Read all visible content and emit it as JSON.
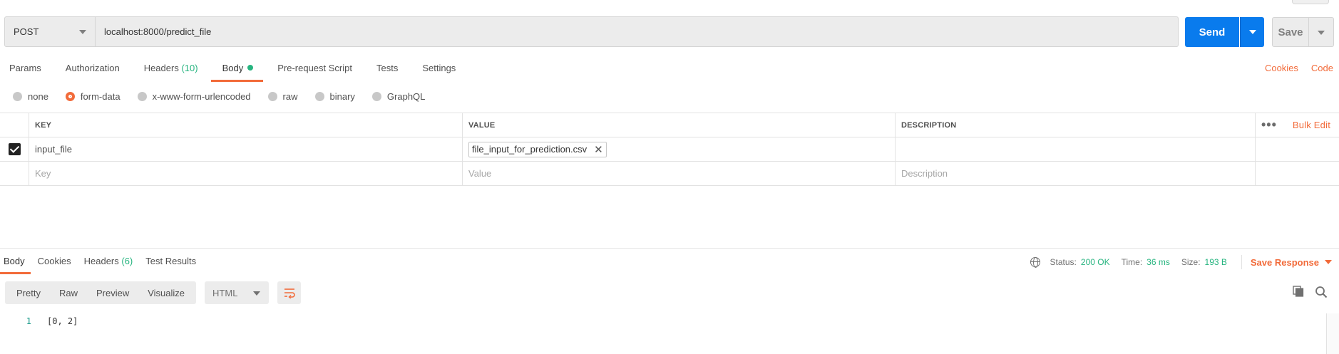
{
  "request": {
    "method": "POST",
    "url": "localhost:8000/predict_file",
    "send_label": "Send",
    "save_label": "Save"
  },
  "req_tabs": [
    {
      "label": "Params"
    },
    {
      "label": "Authorization"
    },
    {
      "label": "Headers",
      "count": "(10)"
    },
    {
      "label": "Body",
      "active": true
    },
    {
      "label": "Pre-request Script"
    },
    {
      "label": "Tests"
    },
    {
      "label": "Settings"
    }
  ],
  "right_links": {
    "cookies": "Cookies",
    "code": "Code"
  },
  "body_types": [
    {
      "label": "none"
    },
    {
      "label": "form-data",
      "selected": true
    },
    {
      "label": "x-www-form-urlencoded"
    },
    {
      "label": "raw"
    },
    {
      "label": "binary"
    },
    {
      "label": "GraphQL"
    }
  ],
  "table": {
    "headers": {
      "key": "KEY",
      "value": "VALUE",
      "description": "DESCRIPTION",
      "bulk_edit": "Bulk Edit"
    },
    "rows": [
      {
        "key": "input_file",
        "file": "file_input_for_prediction.csv",
        "checked": true
      }
    ],
    "placeholders": {
      "key": "Key",
      "value": "Value",
      "description": "Description"
    }
  },
  "response": {
    "tabs": [
      {
        "label": "Body",
        "active": true
      },
      {
        "label": "Cookies"
      },
      {
        "label": "Headers",
        "count": "(6)"
      },
      {
        "label": "Test Results"
      }
    ],
    "status_label": "Status:",
    "status_value": "200 OK",
    "time_label": "Time:",
    "time_value": "36 ms",
    "size_label": "Size:",
    "size_value": "193 B",
    "save_response": "Save Response",
    "views": [
      "Pretty",
      "Raw",
      "Preview",
      "Visualize"
    ],
    "format": "HTML",
    "lines": [
      {
        "num": "1",
        "text": "[0, 2]"
      }
    ]
  },
  "colors": {
    "accent": "#f26b3a",
    "send": "#097bed",
    "success": "#26b47f"
  }
}
